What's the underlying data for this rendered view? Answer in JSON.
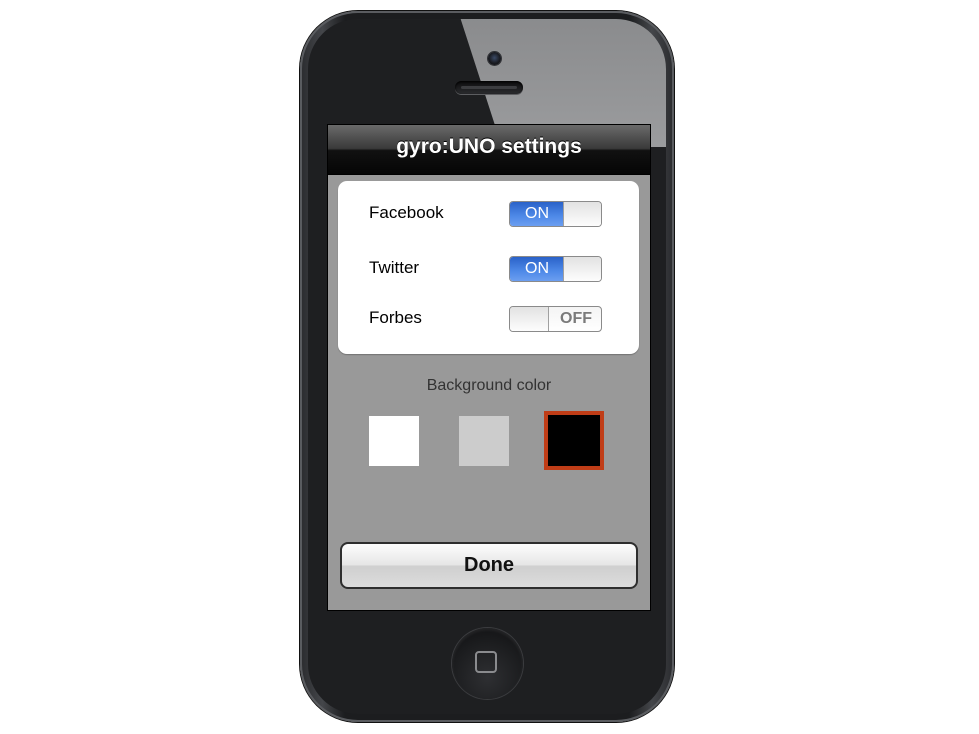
{
  "navbar": {
    "title": "gyro:UNO settings"
  },
  "settings": [
    {
      "label": "Facebook",
      "state": "ON",
      "on": true
    },
    {
      "label": "Twitter",
      "state": "ON",
      "on": true
    },
    {
      "label": "Forbes",
      "state": "OFF",
      "on": false
    }
  ],
  "background_color": {
    "title": "Background color",
    "options": [
      {
        "name": "white",
        "color": "#ffffff",
        "selected": false
      },
      {
        "name": "gray",
        "color": "#cccccc",
        "selected": false
      },
      {
        "name": "black",
        "color": "#000000",
        "selected": true
      }
    ],
    "selection_border_color": "#c03d17"
  },
  "done_button": {
    "label": "Done"
  },
  "icons": {
    "home": "home-square-icon",
    "camera": "camera-icon",
    "speaker": "speaker-icon"
  }
}
